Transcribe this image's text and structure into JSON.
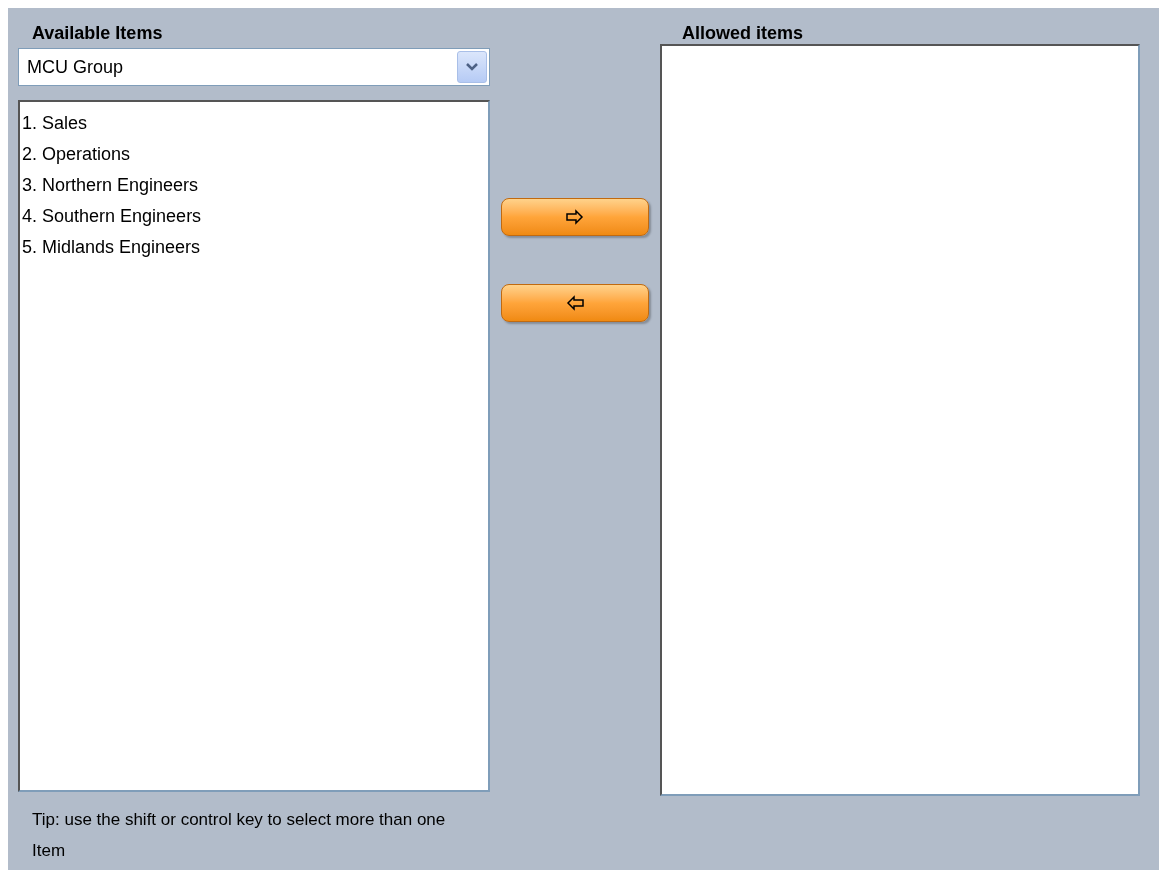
{
  "available": {
    "title": "Available Items",
    "dropdown": {
      "value": "MCU Group"
    },
    "items": [
      {
        "label": "1. Sales",
        "selected": false
      },
      {
        "label": "2. Operations",
        "selected": false
      },
      {
        "label": "3. Northern Engineers",
        "selected": false
      },
      {
        "label": "4. Southern Engineers",
        "selected": false
      },
      {
        "label": "5. Midlands Engineers",
        "selected": false
      }
    ],
    "tip": "Tip: use the shift or control key to select more than one Item"
  },
  "allowed": {
    "title": "Allowed items"
  }
}
